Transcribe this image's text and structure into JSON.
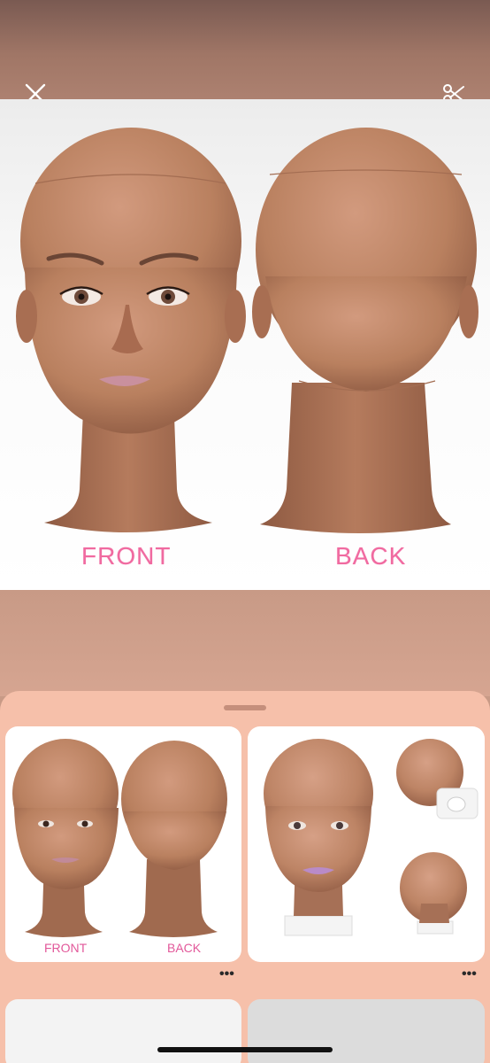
{
  "toolbar": {
    "close_icon": "close-icon",
    "scissors_icon": "scissors-icon"
  },
  "hero": {
    "front_label": "FRONT",
    "back_label": "BACK"
  },
  "results": {
    "items": [
      {
        "front_label": "FRONT",
        "back_label": "BACK",
        "more": "•••"
      },
      {
        "more": "•••"
      }
    ]
  },
  "colors": {
    "label_pink": "#f06aa0",
    "sheet_bg": "#f6c0aa",
    "skin": "#b57a60"
  }
}
